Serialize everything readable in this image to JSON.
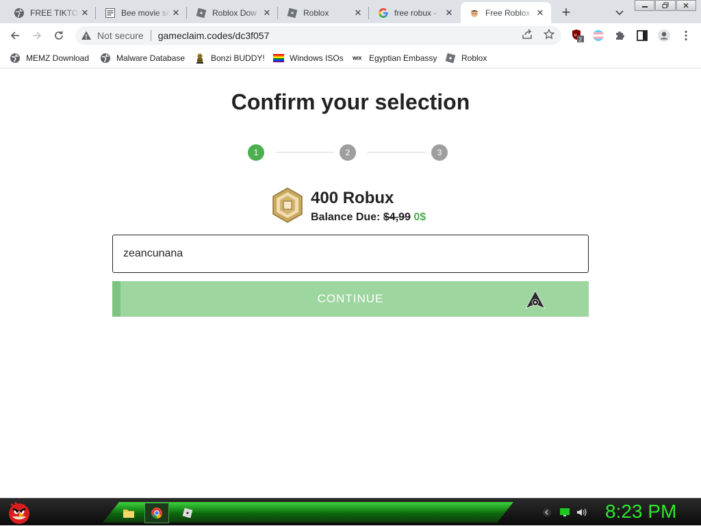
{
  "tabs": [
    {
      "title": "FREE TIKTOK",
      "icon": "globe-icon"
    },
    {
      "title": "Bee movie sc",
      "icon": "document-icon"
    },
    {
      "title": "Roblox Dow",
      "icon": "roblox-icon"
    },
    {
      "title": "Roblox",
      "icon": "roblox-icon"
    },
    {
      "title": "free robux -",
      "icon": "google-icon"
    },
    {
      "title": "Free Roblox",
      "icon": "avatar-favicon-icon",
      "active": true
    }
  ],
  "toolbar": {
    "not_secure": "Not secure",
    "url": "gameclaim.codes/dc3f057",
    "extension_badge": "2"
  },
  "bookmarks": [
    {
      "label": "MEMZ Download",
      "icon": "globe-icon"
    },
    {
      "label": "Malware Database",
      "icon": "globe-icon"
    },
    {
      "label": "Bonzi BUDDY!",
      "icon": "bonzi-icon"
    },
    {
      "label": "Windows ISOs",
      "icon": "rainbow-flag-icon"
    },
    {
      "label": "Egyptian Embassy",
      "icon": "wix-icon"
    },
    {
      "label": "Roblox",
      "icon": "roblox-icon"
    }
  ],
  "page": {
    "heading": "Confirm your selection",
    "steps": [
      "1",
      "2",
      "3"
    ],
    "active_step": 1,
    "product_name": "400 Robux",
    "balance_label": "Balance Due:",
    "old_price": "$4,99",
    "new_price": "0$",
    "username_value": "zeancunana",
    "continue_label": "CONTINUE"
  },
  "colors": {
    "step_active": "#4caf50",
    "step_inactive": "#9e9e9e",
    "continue_bg": "#9dd69f",
    "price_green": "#4caf50"
  },
  "taskbar": {
    "clock": "8:23 PM"
  }
}
